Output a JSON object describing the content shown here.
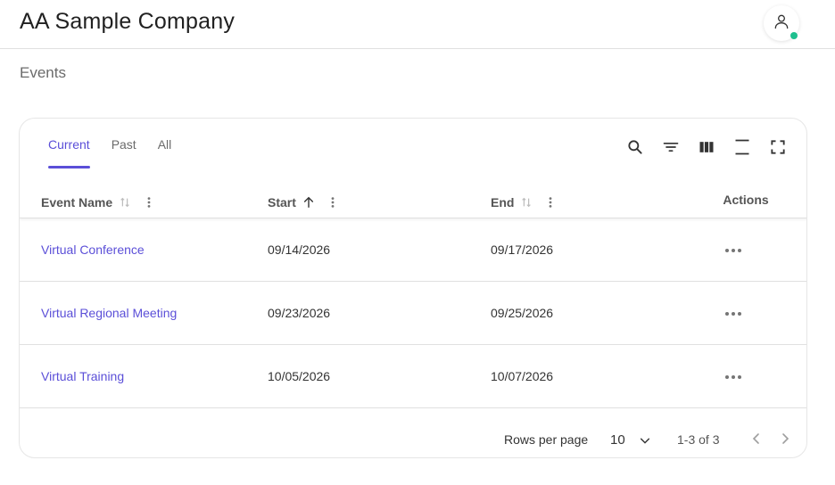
{
  "header": {
    "company_name": "AA Sample Company",
    "user_icon": "user-icon",
    "status_color": "#1dbf8e"
  },
  "page": {
    "title": "Events"
  },
  "tabs": [
    {
      "label": "Current",
      "active": true
    },
    {
      "label": "Past",
      "active": false
    },
    {
      "label": "All",
      "active": false
    }
  ],
  "toolbar": [
    "search-icon",
    "filter-icon",
    "columns-icon",
    "density-icon",
    "fullscreen-icon"
  ],
  "table": {
    "columns": [
      {
        "label": "Event Name",
        "sort": "none"
      },
      {
        "label": "Start",
        "sort": "asc"
      },
      {
        "label": "End",
        "sort": "none"
      }
    ],
    "actions_label": "Actions",
    "rows": [
      {
        "name": "Virtual Conference",
        "start": "09/14/2026",
        "end": "09/17/2026"
      },
      {
        "name": "Virtual Regional Meeting",
        "start": "09/23/2026",
        "end": "09/25/2026"
      },
      {
        "name": "Virtual Training",
        "start": "10/05/2026",
        "end": "10/07/2026"
      }
    ]
  },
  "pagination": {
    "rows_per_page_label": "Rows per page",
    "rows_per_page_value": "10",
    "range_text": "1-3 of 3"
  },
  "colors": {
    "accent": "#5b4fd8"
  }
}
